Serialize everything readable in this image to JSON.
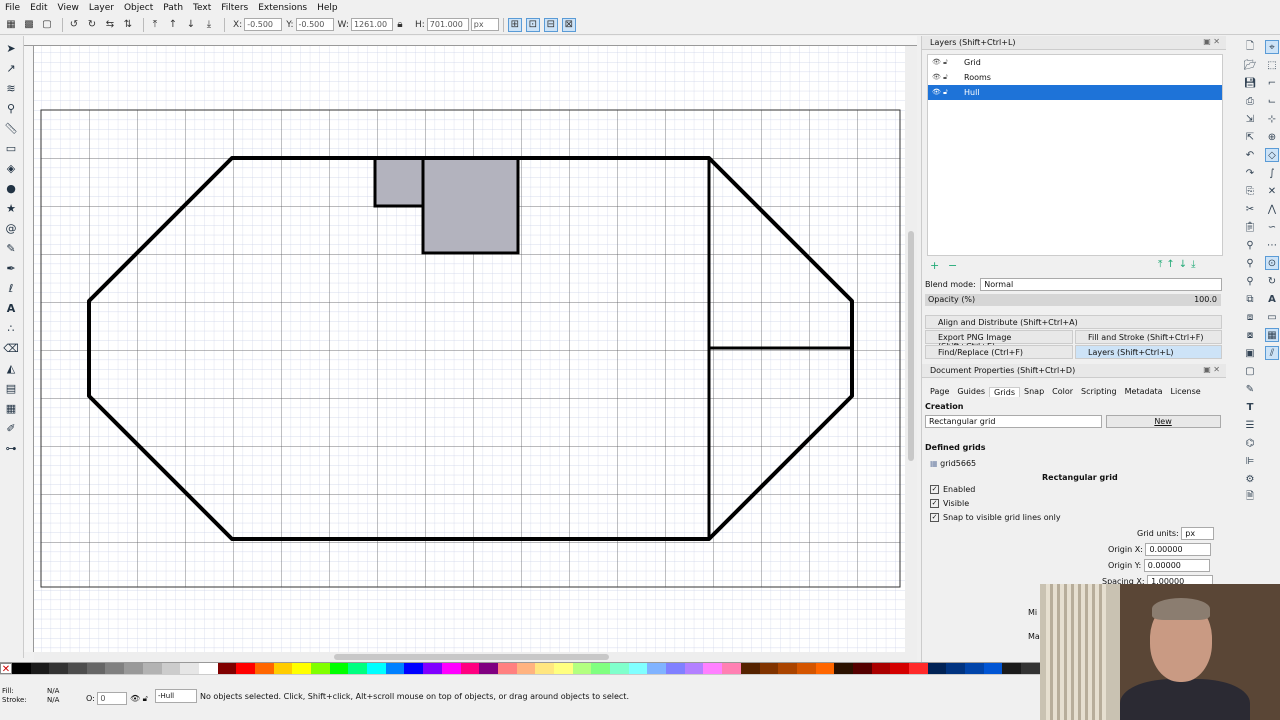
{
  "menu": [
    "File",
    "Edit",
    "View",
    "Layer",
    "Object",
    "Path",
    "Text",
    "Filters",
    "Extensions",
    "Help"
  ],
  "toolcontrols": {
    "x_label": "X:",
    "x_value": "-0.500",
    "y_label": "Y:",
    "y_value": "-0.500",
    "w_label": "W:",
    "w_value": "1261.00",
    "h_label": "H:",
    "h_value": "701.000",
    "unit": "px"
  },
  "layers_panel": {
    "title": "Layers (Shift+Ctrl+L)",
    "layers": [
      {
        "name": "Grid",
        "selected": false
      },
      {
        "name": "Rooms",
        "selected": false
      },
      {
        "name": "Hull",
        "selected": true
      }
    ],
    "blend_label": "Blend mode:",
    "blend_value": "Normal",
    "opacity_label": "Opacity (%)",
    "opacity_value": "100.0"
  },
  "collapsed_panels": {
    "align": "Align and Distribute (Shift+Ctrl+A)",
    "export": "Export PNG Image (Shift+Ctrl+E)",
    "fill_stroke": "Fill and Stroke (Shift+Ctrl+F)",
    "find": "Find/Replace (Ctrl+F)",
    "layers_tab": "Layers (Shift+Ctrl+L)"
  },
  "doc_props": {
    "title": "Document Properties (Shift+Ctrl+D)",
    "tabs": [
      "Page",
      "Guides",
      "Grids",
      "Snap",
      "Color",
      "Scripting",
      "Metadata",
      "License"
    ],
    "active_tab": "Grids",
    "creation_label": "Creation",
    "grid_type": "Rectangular grid",
    "new_button": "New",
    "defined_label": "Defined grids",
    "grid_id": "grid5665",
    "grid_heading": "Rectangular grid",
    "enabled": "Enabled",
    "visible": "Visible",
    "snap_visible": "Snap to visible grid lines only",
    "grid_units_label": "Grid units:",
    "grid_units": "px",
    "origin_x_label": "Origin X:",
    "origin_x": "0.00000",
    "origin_y_label": "Origin Y:",
    "origin_y": "0.00000",
    "spacing_x_label": "Spacing X:",
    "spacing_x": "1.00000",
    "cut_1": "Mi",
    "cut_2": "Ma"
  },
  "status": {
    "fill_label": "Fill:",
    "fill_value": "N/A",
    "stroke_label": "Stroke:",
    "stroke_value": "N/A",
    "o_label": "O:",
    "o_value": "0",
    "layer": "-Hull",
    "message": "No objects selected. Click, Shift+click, Alt+scroll mouse on top of objects, or drag around objects to select."
  },
  "palette_colors": [
    "#000000",
    "#1a1a1a",
    "#333333",
    "#4d4d4d",
    "#666666",
    "#808080",
    "#999999",
    "#b3b3b3",
    "#cccccc",
    "#e6e6e6",
    "#ffffff",
    "#800000",
    "#ff0000",
    "#ff6600",
    "#ffcc00",
    "#ffff00",
    "#80ff00",
    "#00ff00",
    "#00ff80",
    "#00ffff",
    "#0080ff",
    "#0000ff",
    "#8000ff",
    "#ff00ff",
    "#ff0080",
    "#800080",
    "#ff8080",
    "#ffb380",
    "#ffe680",
    "#ffff80",
    "#b3ff80",
    "#80ff80",
    "#80ffcc",
    "#80ffff",
    "#80b3ff",
    "#8080ff",
    "#b380ff",
    "#ff80ff",
    "#ff80b3",
    "#552200",
    "#803300",
    "#aa4400",
    "#d45500",
    "#ff6600",
    "#2b1100",
    "#550000",
    "#aa0000",
    "#d40000",
    "#ff2a2a",
    "#002255",
    "#003380",
    "#0044aa",
    "#0055d4",
    "#1a1a1a",
    "#333333"
  ]
}
